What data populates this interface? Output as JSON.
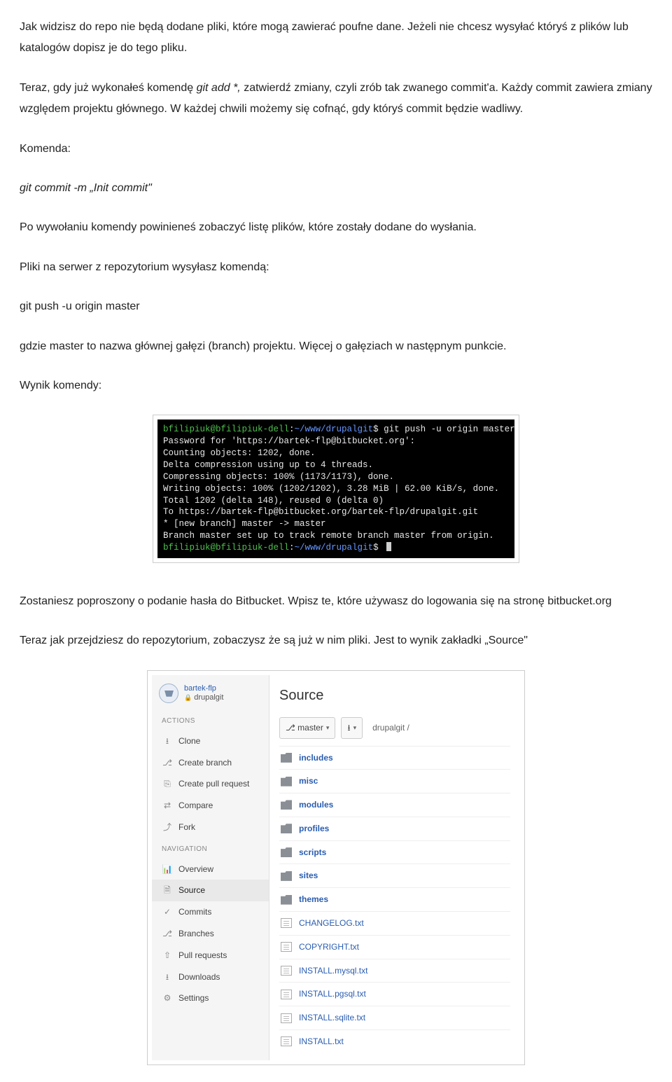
{
  "paragraphs": {
    "p1": "Jak widzisz do repo nie będą dodane pliki, które mogą zawierać poufne dane. Jeżeli nie chcesz wysyłać któryś z plików lub katalogów dopisz je do tego pliku.",
    "p2_a": "Teraz, gdy już wykonałeś komendę ",
    "p2_cmd": "git add *,",
    "p2_b": " zatwierdź zmiany, czyli zrób tak zwanego commit'a. Każdy commit zawiera zmiany względem projektu głównego. W każdej chwili możemy się cofnąć, gdy któryś commit będzie wadliwy.",
    "p3": "Komenda:",
    "p4_cmd": "git commit -m „Init commit\"",
    "p5": "Po wywołaniu komendy powinieneś zobaczyć listę plików, które zostały dodane do wysłania.",
    "p6": "Pliki na serwer z repozytorium wysyłasz komendą:",
    "p7_cmd": "git push -u origin master",
    "p8": "gdzie master to nazwa głównej gałęzi (branch) projektu. Więcej o gałęziach w następnym punkcie.",
    "p9": "Wynik komendy:",
    "p10": "Zostaniesz poproszony o podanie hasła do Bitbucket. Wpisz te, które używasz do logowania się na stronę bitbucket.org",
    "p11": "Teraz jak przejdziesz do repozytorium, zobaczysz że są już w nim pliki. Jest to wynik zakładki „Source\""
  },
  "terminal": {
    "prompt_user": "bfilipiuk@bfilipiuk-dell",
    "prompt_sep": ":",
    "prompt_path": "~/www/drupalgit",
    "prompt_suffix": "$",
    "lines": [
      "git push -u origin master",
      "Password for 'https://bartek-flp@bitbucket.org':",
      "Counting objects: 1202, done.",
      "Delta compression using up to 4 threads.",
      "Compressing objects: 100% (1173/1173), done.",
      "Writing objects: 100% (1202/1202), 3.28 MiB | 62.00 KiB/s, done.",
      "Total 1202 (delta 148), reused 0 (delta 0)",
      "To https://bartek-flp@bitbucket.org/bartek-flp/drupalgit.git",
      " * [new branch]      master -> master",
      "Branch master set up to track remote branch master from origin."
    ]
  },
  "bitbucket": {
    "owner": "bartek-flp",
    "repo": "drupalgit",
    "sections": {
      "actions": "ACTIONS",
      "navigation": "NAVIGATION"
    },
    "actions": [
      {
        "icon": "⭳",
        "label": "Clone",
        "name": "sidebar-item-clone"
      },
      {
        "icon": "⎇",
        "label": "Create branch",
        "name": "sidebar-item-create-branch"
      },
      {
        "icon": "⎘",
        "label": "Create pull request",
        "name": "sidebar-item-create-pr"
      },
      {
        "icon": "⇄",
        "label": "Compare",
        "name": "sidebar-item-compare"
      },
      {
        "icon": "⤴",
        "label": "Fork",
        "name": "sidebar-item-fork"
      }
    ],
    "nav": [
      {
        "icon": "📊",
        "label": "Overview",
        "name": "sidebar-item-overview",
        "active": false
      },
      {
        "icon": "🗎",
        "label": "Source",
        "name": "sidebar-item-source",
        "active": true
      },
      {
        "icon": "✓",
        "label": "Commits",
        "name": "sidebar-item-commits",
        "active": false
      },
      {
        "icon": "⎇",
        "label": "Branches",
        "name": "sidebar-item-branches",
        "active": false
      },
      {
        "icon": "⇧",
        "label": "Pull requests",
        "name": "sidebar-item-prs",
        "active": false
      },
      {
        "icon": "⭳",
        "label": "Downloads",
        "name": "sidebar-item-downloads",
        "active": false
      },
      {
        "icon": "⚙",
        "label": "Settings",
        "name": "sidebar-item-settings",
        "active": false
      }
    ],
    "main": {
      "title": "Source",
      "branch_icon": "⎇",
      "branch": "master",
      "dl_icon": "⭳",
      "crumb": "drupalgit /"
    },
    "files": [
      {
        "type": "folder",
        "name": "includes"
      },
      {
        "type": "folder",
        "name": "misc"
      },
      {
        "type": "folder",
        "name": "modules"
      },
      {
        "type": "folder",
        "name": "profiles"
      },
      {
        "type": "folder",
        "name": "scripts"
      },
      {
        "type": "folder",
        "name": "sites"
      },
      {
        "type": "folder",
        "name": "themes"
      },
      {
        "type": "file",
        "name": "CHANGELOG.txt"
      },
      {
        "type": "file",
        "name": "COPYRIGHT.txt"
      },
      {
        "type": "file",
        "name": "INSTALL.mysql.txt"
      },
      {
        "type": "file",
        "name": "INSTALL.pgsql.txt"
      },
      {
        "type": "file",
        "name": "INSTALL.sqlite.txt"
      },
      {
        "type": "file",
        "name": "INSTALL.txt"
      }
    ]
  }
}
